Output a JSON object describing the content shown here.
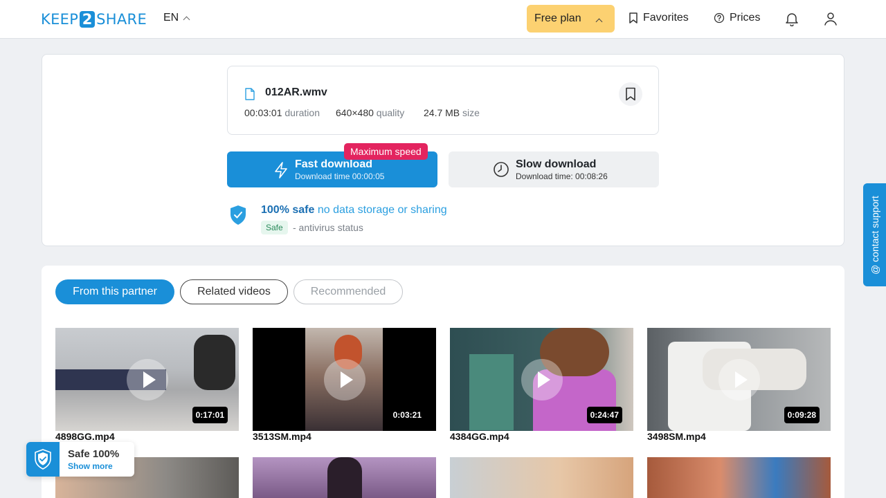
{
  "header": {
    "logo_left": "KEEP",
    "logo_mid": "2",
    "logo_right": "SHARE",
    "language": "EN",
    "plan": "Free plan",
    "favorites": "Favorites",
    "prices": "Prices"
  },
  "file": {
    "name": "012AR.wmv",
    "duration_value": "00:03:01",
    "duration_label": "duration",
    "quality_value": "640×480",
    "quality_label": "quality",
    "size_value": "24.7 MB",
    "size_label": "size"
  },
  "download": {
    "badge": "Maximum speed",
    "fast_title": "Fast download",
    "fast_time": "Download time 00:00:05",
    "slow_title": "Slow download",
    "slow_time": "Download time: 00:08:26"
  },
  "safety": {
    "strong": "100% safe",
    "rest": " no data storage or sharing",
    "badge": "Safe",
    "antivirus": "- antivirus status"
  },
  "tabs": [
    {
      "label": "From this partner"
    },
    {
      "label": "Related videos"
    },
    {
      "label": "Recommended"
    }
  ],
  "videos": [
    {
      "name": "4898GG.mp4",
      "duration": "0:17:01"
    },
    {
      "name": "3513SM.mp4",
      "duration": "0:03:21"
    },
    {
      "name": "4384GG.mp4",
      "duration": "0:24:47"
    },
    {
      "name": "3498SM.mp4",
      "duration": "0:09:28"
    }
  ],
  "support": "@ contact support",
  "widget": {
    "title": "Safe 100%",
    "link": "Show more"
  },
  "colors": {
    "accent": "#1a8fd8",
    "plan": "#fcd171",
    "badge": "#e3245f"
  }
}
